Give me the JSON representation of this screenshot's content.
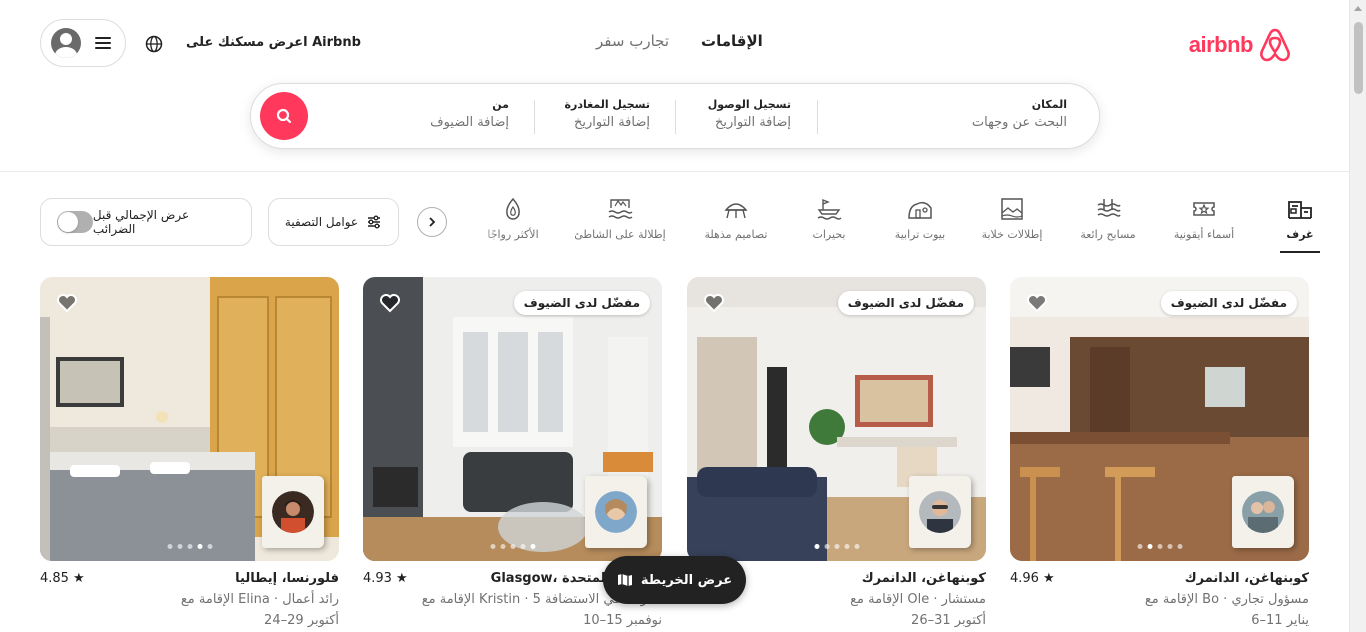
{
  "header": {
    "brand": "airbnb",
    "tabs": [
      {
        "label": "الإقامات",
        "active": true
      },
      {
        "label": "تجارب سفر",
        "active": false
      }
    ],
    "host_link": "اعرض مسكنك على Airbnb",
    "brand_color": "#ff385c"
  },
  "search": {
    "where_label": "المكان",
    "where_value": "البحث عن وجهات",
    "checkin_label": "تسجيل الوصول",
    "checkin_value": "إضافة التواريخ",
    "checkout_label": "تسجيل المغادرة",
    "checkout_value": "إضافة التواريخ",
    "who_label": "من",
    "who_value": "إضافة الضيوف"
  },
  "categories": [
    {
      "label": "غرف",
      "icon": "rooms-icon",
      "active": true
    },
    {
      "label": "أسماء أيقونية",
      "icon": "icons-icon",
      "active": false
    },
    {
      "label": "مسابح رائعة",
      "icon": "pool-icon",
      "active": false
    },
    {
      "label": "إطلالات خلابة",
      "icon": "views-icon",
      "active": false
    },
    {
      "label": "بيوت ترابية",
      "icon": "earth-homes-icon",
      "active": false
    },
    {
      "label": "بحيرات",
      "icon": "lake-icon",
      "active": false
    },
    {
      "label": "تصاميم مذهلة",
      "icon": "design-icon",
      "active": false
    },
    {
      "label": "إطلالة على الشاطئ",
      "icon": "beach-icon",
      "active": false
    },
    {
      "label": "الأكثر رواجًا",
      "icon": "trending-icon",
      "active": false
    }
  ],
  "filters": {
    "filters_label": "عوامل التصفية",
    "tax_label": "عرض الإجمالي قبل الضرائب"
  },
  "listings": [
    {
      "title": "كوبنهاغن، الدانمرك",
      "rating": "4.96",
      "sub": "الإقامة مع Bo · مسؤول تجاري",
      "dates": "6–11 يناير",
      "badge": "مفضّل لدى الضيوف"
    },
    {
      "title": "كوبنهاغن، الدانمرك",
      "rating": "",
      "sub": "الإقامة مع Ole · مستشار",
      "dates": "26–31 أكتوبر",
      "badge": "مفضّل لدى الضيوف"
    },
    {
      "title": "Glasgow، المملكة المتحدة",
      "rating": "4.93",
      "sub": "الإقامة مع Kristin · 5 سنوات في الاستضافة",
      "dates": "10–15 نوفمبر",
      "badge": "مفضّل لدى الضيوف"
    },
    {
      "title": "فلورنسا، إيطاليا",
      "rating": "4.85",
      "sub": "الإقامة مع Elina · رائد أعمال",
      "dates": "24–29 أكتوبر",
      "badge": ""
    }
  ],
  "map_button": "عرض الخريطة"
}
